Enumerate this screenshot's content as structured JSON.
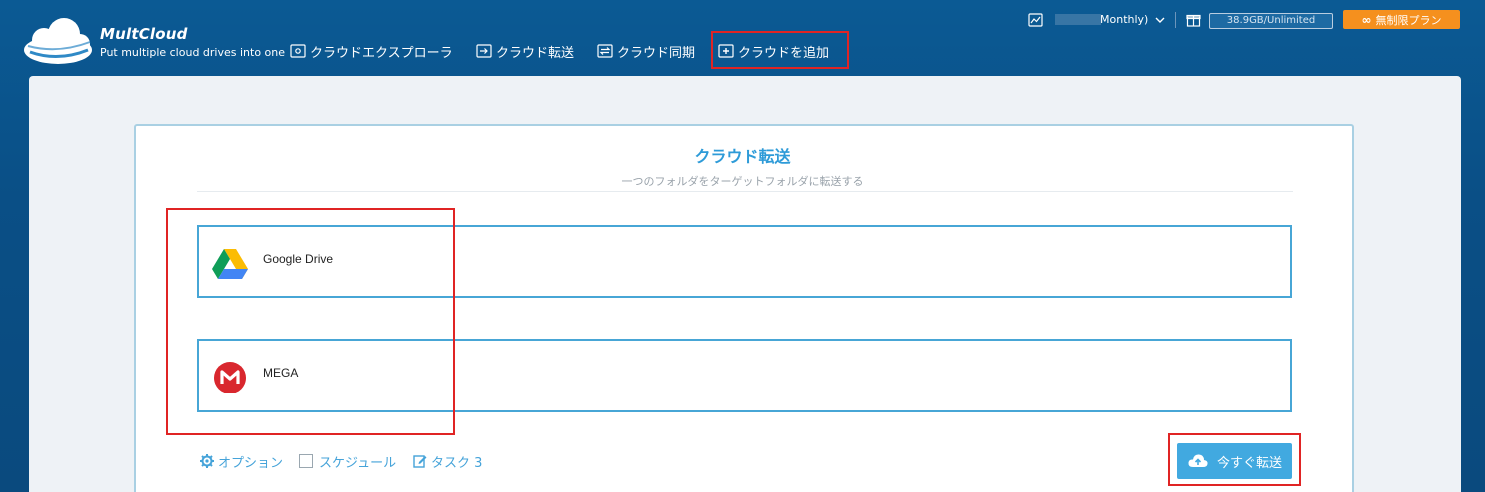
{
  "brand": {
    "name": "MultCloud",
    "tagline": "Put multiple cloud drives into one"
  },
  "nav": {
    "items": [
      {
        "label": "クラウドエクスプローラ",
        "icon": "explorer-icon"
      },
      {
        "label": "クラウド転送",
        "icon": "transfer-icon"
      },
      {
        "label": "クラウド同期",
        "icon": "sync-icon"
      },
      {
        "label": "クラウドを追加",
        "icon": "add-cloud-icon"
      }
    ]
  },
  "account": {
    "plan_label": "Monthly)",
    "storage": "38.9GB/Unlimited",
    "upgrade_label": "無制限プラン"
  },
  "transfer": {
    "title": "クラウド転送",
    "subtitle": "一つのフォルダをターゲットフォルダに転送する",
    "source": {
      "label": "Google Drive",
      "icon": "google-drive-icon"
    },
    "target": {
      "label": "MEGA",
      "icon": "mega-icon"
    },
    "options_label": "オプション",
    "schedule_label": "スケジュール",
    "task_label": "タスク 3",
    "transfer_now_label": "今すぐ転送"
  },
  "colors": {
    "header_bg": "#0a4f86",
    "accent": "#41a9e0",
    "upgrade": "#f5901e",
    "highlight": "#e02424"
  }
}
